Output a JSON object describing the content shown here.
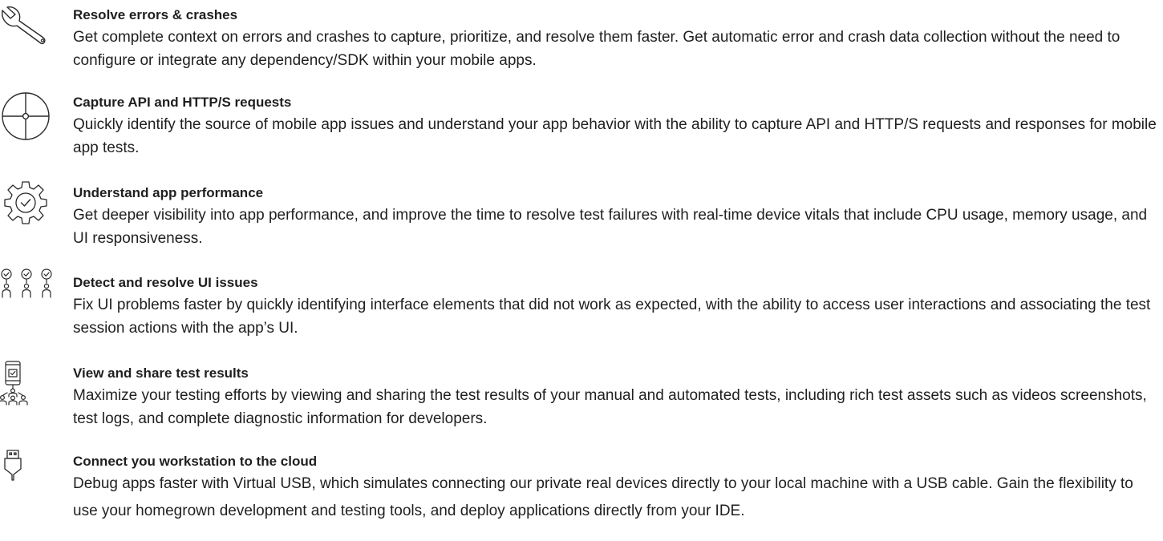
{
  "features": [
    {
      "icon": "wrench-icon",
      "title": "Resolve errors & crashes",
      "description": "Get complete context on errors and crashes to capture, prioritize, and resolve them faster. Get automatic error and crash data collection without the need to configure or integrate any dependency/SDK within your mobile apps."
    },
    {
      "icon": "crosshair-icon",
      "title": "Capture API and HTTP/S requests",
      "description": "Quickly identify the source of mobile app issues and understand your app behavior with the ability to capture API and HTTP/S requests and responses for mobile app tests."
    },
    {
      "icon": "gear-check-icon",
      "title": "Understand app performance",
      "description": "Get deeper visibility into app performance, and improve the time to resolve test failures with real-time device vitals that include CPU usage, memory usage, and UI responsiveness."
    },
    {
      "icon": "users-check-icon",
      "title": "Detect and resolve UI issues",
      "description": "Fix UI problems faster by quickly identifying interface elements that did not work as expected, with the ability to access user interactions and associating the test session actions with the app’s UI."
    },
    {
      "icon": "phone-share-icon",
      "title": "View and share test results",
      "description": "Maximize your testing efforts by viewing and sharing the test results of your manual and automated tests, including rich test assets such as videos screenshots, test logs, and complete diagnostic information for developers."
    },
    {
      "icon": "usb-icon",
      "title": "Connect you workstation to the cloud",
      "description": "Debug apps faster with Virtual USB, which simulates connecting our private real devices directly to your local machine with a USB cable. Gain the flexibility to use your homegrown development and testing tools, and deploy applications directly from your IDE."
    }
  ]
}
